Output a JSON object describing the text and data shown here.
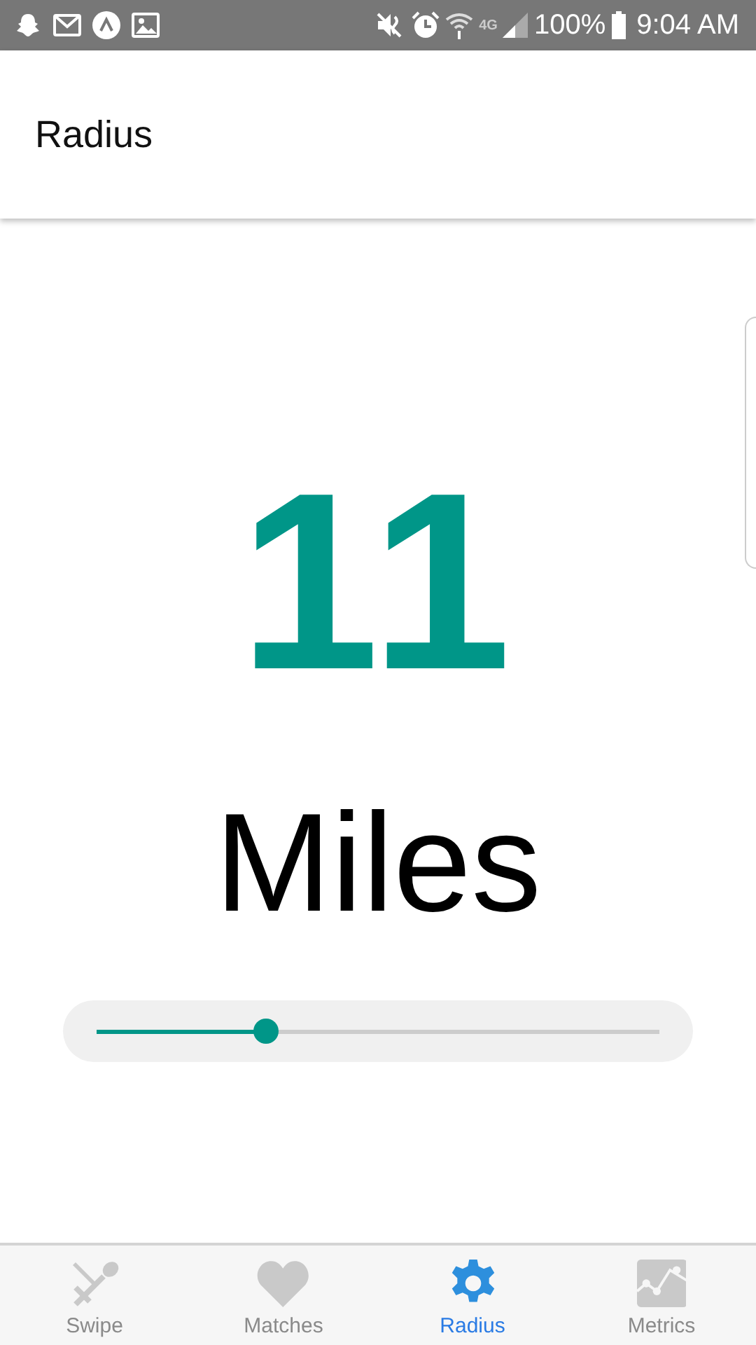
{
  "status_bar": {
    "network": "4G",
    "battery": "100%",
    "time": "9:04 AM"
  },
  "header": {
    "title": "Radius"
  },
  "radius": {
    "value": "11",
    "unit": "Miles",
    "level": 0.3
  },
  "tabs": [
    {
      "label": "Swipe",
      "kind": "utensils",
      "selected": false
    },
    {
      "label": "Matches",
      "kind": "heart",
      "selected": false
    },
    {
      "label": "Radius",
      "kind": "gear",
      "selected": true
    },
    {
      "label": "Metrics",
      "kind": "chart",
      "selected": false
    }
  ]
}
